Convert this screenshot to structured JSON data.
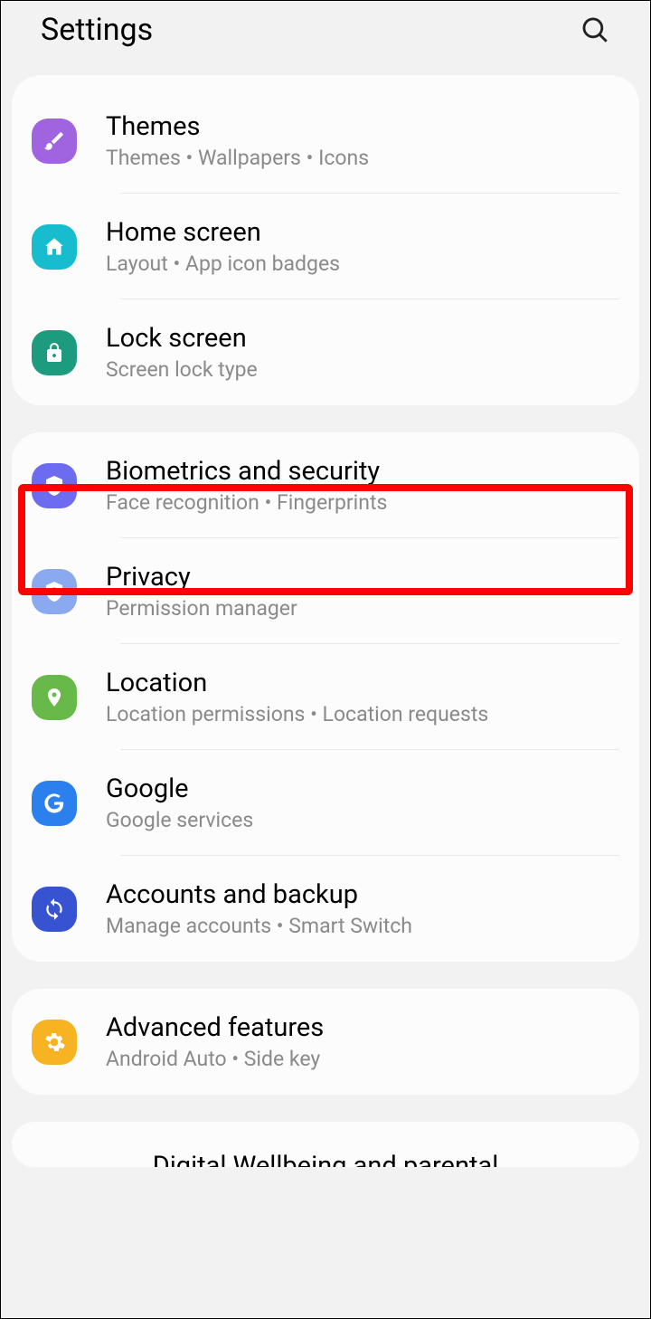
{
  "header": {
    "title": "Settings"
  },
  "groups": [
    {
      "items": [
        {
          "id": "themes",
          "title": "Themes",
          "subtitle": "Themes  •  Wallpapers  •  Icons",
          "iconColor": "bg-purple"
        },
        {
          "id": "home-screen",
          "title": "Home screen",
          "subtitle": "Layout  •  App icon badges",
          "iconColor": "bg-teal"
        },
        {
          "id": "lock-screen",
          "title": "Lock screen",
          "subtitle": "Screen lock type",
          "iconColor": "bg-green"
        }
      ]
    },
    {
      "items": [
        {
          "id": "biometrics",
          "title": "Biometrics and security",
          "subtitle": "Face recognition  •  Fingerprints",
          "iconColor": "bg-indigo"
        },
        {
          "id": "privacy",
          "title": "Privacy",
          "subtitle": "Permission manager",
          "iconColor": "bg-lightblue"
        },
        {
          "id": "location",
          "title": "Location",
          "subtitle": "Location permissions  •  Location requests",
          "iconColor": "bg-greenleaf"
        },
        {
          "id": "google",
          "title": "Google",
          "subtitle": "Google services",
          "iconColor": "bg-blue"
        },
        {
          "id": "accounts",
          "title": "Accounts and backup",
          "subtitle": "Manage accounts  •  Smart Switch",
          "iconColor": "bg-darkblue"
        }
      ]
    },
    {
      "items": [
        {
          "id": "advanced",
          "title": "Advanced features",
          "subtitle": "Android Auto  •  Side key",
          "iconColor": "bg-orange"
        }
      ]
    }
  ],
  "partial": "Digital Wellbeing and parental"
}
